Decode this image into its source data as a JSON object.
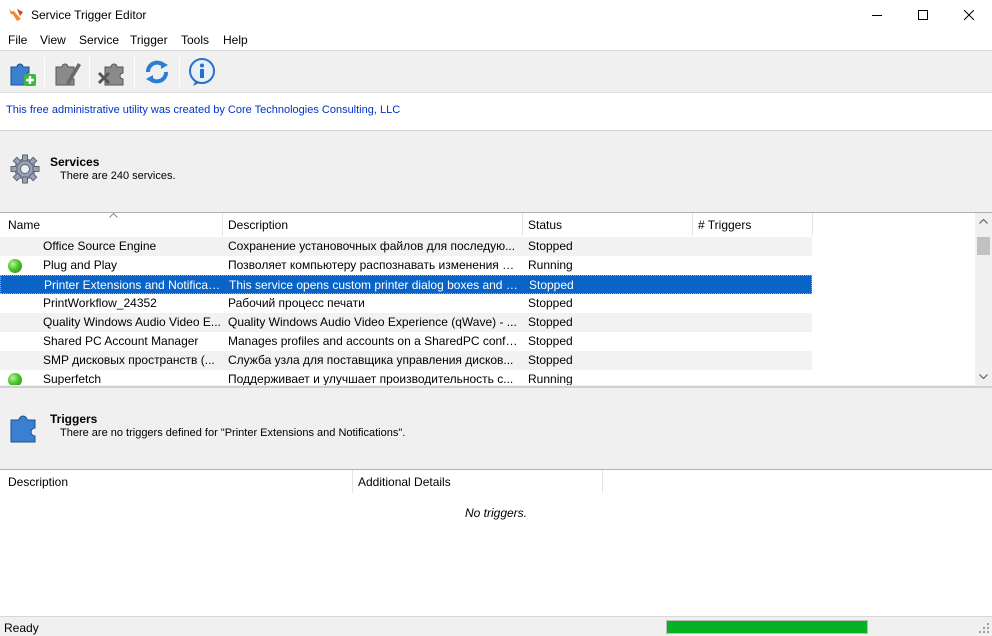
{
  "window": {
    "title": "Service Trigger Editor",
    "controls": [
      "minimize",
      "maximize",
      "close"
    ]
  },
  "menu": [
    "File",
    "View",
    "Service",
    "Trigger",
    "Tools",
    "Help"
  ],
  "toolbar": {
    "buttons": [
      {
        "icon": "add-trigger-icon"
      },
      {
        "icon": "edit-trigger-icon"
      },
      {
        "icon": "delete-trigger-icon"
      },
      {
        "icon": "refresh-icon"
      },
      {
        "icon": "info-icon"
      }
    ]
  },
  "credit": "This free administrative utility was created by Core Technologies Consulting, LLC",
  "services": {
    "title": "Services",
    "subtitle": "There are 240 services.",
    "columns": [
      "Name",
      "Description",
      "Status",
      "# Triggers"
    ],
    "sort_column": "Name",
    "rows": [
      {
        "running": false,
        "name": "Office  Source Engine",
        "description": "Сохранение установочных файлов для последую...",
        "status": "Stopped",
        "triggers": "",
        "selected": false
      },
      {
        "running": true,
        "name": "Plug and Play",
        "description": "Позволяет компьютеру распознавать изменения в...",
        "status": "Running",
        "triggers": "",
        "selected": false
      },
      {
        "running": false,
        "name": "Printer Extensions and Notificati...",
        "description": "This service opens custom printer dialog boxes and h...",
        "status": "Stopped",
        "triggers": "",
        "selected": true
      },
      {
        "running": false,
        "name": "PrintWorkflow_24352",
        "description": "Рабочий процесс печати",
        "status": "Stopped",
        "triggers": "",
        "selected": false
      },
      {
        "running": false,
        "name": "Quality Windows Audio Video E...",
        "description": "Quality Windows Audio Video Experience (qWave) - ...",
        "status": "Stopped",
        "triggers": "",
        "selected": false
      },
      {
        "running": false,
        "name": "Shared PC Account Manager",
        "description": "Manages profiles and accounts on a SharedPC confi...",
        "status": "Stopped",
        "triggers": "",
        "selected": false
      },
      {
        "running": false,
        "name": "SMP дисковых пространств (...",
        "description": "Служба узла для поставщика управления дисков...",
        "status": "Stopped",
        "triggers": "",
        "selected": false
      },
      {
        "running": true,
        "name": "Superfetch",
        "description": "Поддерживает и улучшает производительность с...",
        "status": "Running",
        "triggers": "",
        "selected": false
      }
    ]
  },
  "triggers": {
    "title": "Triggers",
    "subtitle": "There are no triggers defined for \"Printer Extensions and Notifications\".",
    "columns": [
      "Description",
      "Additional Details"
    ],
    "empty_text": "No triggers."
  },
  "statusbar": {
    "text": "Ready",
    "progress_fraction": 1.0
  },
  "colors": {
    "selection": "#0a64c8",
    "link": "#0033cc",
    "running_dot": "#4cc22a"
  }
}
